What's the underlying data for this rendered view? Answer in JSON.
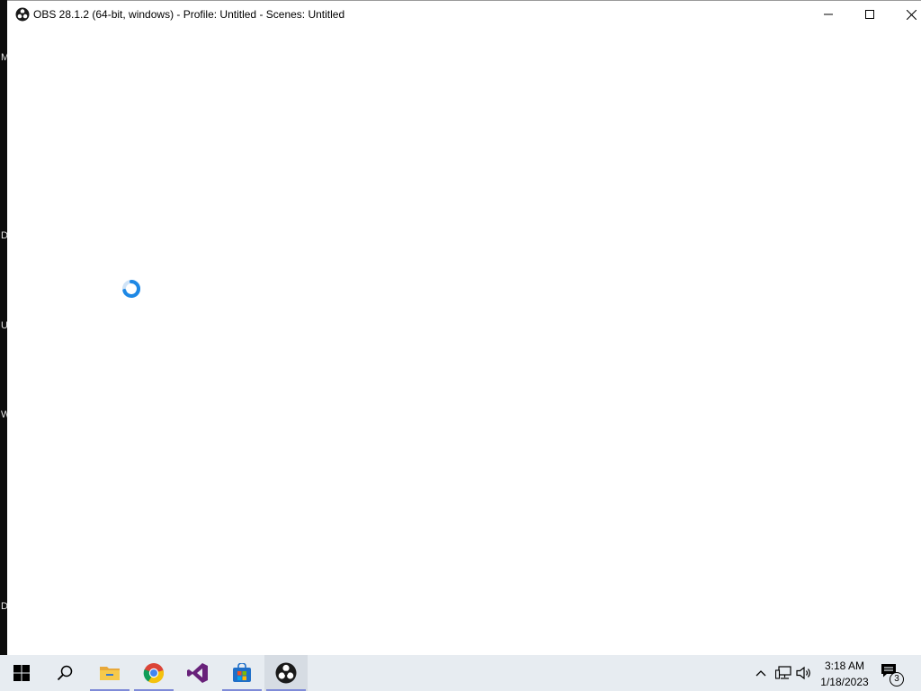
{
  "window": {
    "title": "OBS 28.1.2 (64-bit, windows) - Profile: Untitled - Scenes: Untitled",
    "controls": [
      "minimize-icon",
      "maximize-icon",
      "close-icon"
    ]
  },
  "desktop_edge_letters": [
    "M",
    "D",
    "U",
    "W",
    "D"
  ],
  "taskbar": {
    "items": [
      {
        "name": "start",
        "icon": "windows-logo-icon"
      },
      {
        "name": "search",
        "icon": "search-icon"
      },
      {
        "name": "file-explorer",
        "icon": "folder-icon"
      },
      {
        "name": "chrome",
        "icon": "chrome-icon"
      },
      {
        "name": "visual-studio",
        "icon": "visual-studio-icon"
      },
      {
        "name": "store",
        "icon": "store-icon"
      },
      {
        "name": "obs",
        "icon": "obs-icon"
      }
    ],
    "clock_time": "3:18 AM",
    "clock_date": "1/18/2023",
    "notification_count": "3"
  },
  "colors": {
    "taskbar_bg": "#e7ecf1",
    "accent_underline": "#7f8bd8",
    "spinner_blue": "#1e88e5"
  }
}
